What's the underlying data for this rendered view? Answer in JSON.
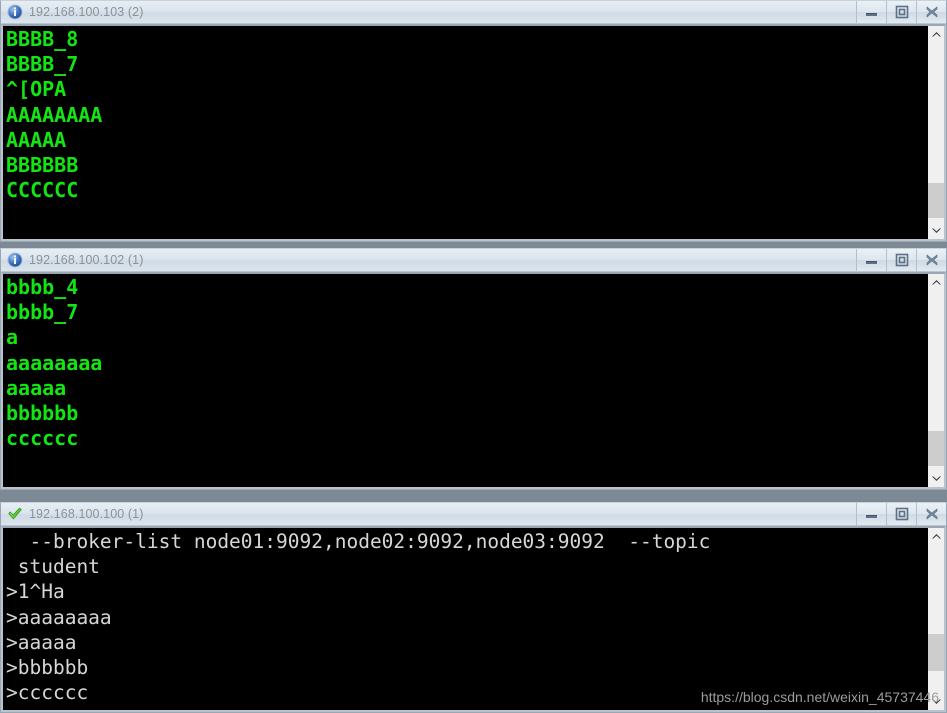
{
  "desktop": {
    "background_color": "#7d8a96",
    "watermark": "https://blog.csdn.net/weixin_45737446"
  },
  "window_buttons": {
    "minimize_label": "Minimize",
    "maximize_label": "Maximize",
    "close_label": "Close"
  },
  "windows": [
    {
      "id": "win-103",
      "title": "192.168.100.103 (2)",
      "icon": "blue-info-icon",
      "text_color": "#13e413",
      "background_color": "#000000",
      "lines": [
        "BBBB_8",
        "BBBB_7",
        "^[OPA",
        "AAAAAAAA",
        "AAAAA",
        "BBBBBB",
        "CCCCCC"
      ],
      "scrollbar": {
        "up_arrow": "scroll-up-icon",
        "down_arrow": "scroll-down-icon",
        "thumb_top_pct": 78,
        "thumb_height_pct": 20
      }
    },
    {
      "id": "win-102",
      "title": "192.168.100.102 (1)",
      "icon": "blue-info-icon",
      "text_color": "#13e413",
      "background_color": "#000000",
      "lines": [
        "bbbb_4",
        "bbbb_7",
        "a",
        "aaaaaaaa",
        "aaaaa",
        "bbbbbb",
        "cccccc"
      ],
      "scrollbar": {
        "up_arrow": "scroll-up-icon",
        "down_arrow": "scroll-down-icon",
        "thumb_top_pct": 78,
        "thumb_height_pct": 20
      }
    },
    {
      "id": "win-100",
      "title": "192.168.100.100 (1)",
      "icon": "green-check-icon",
      "text_color": "#d6d6d6",
      "background_color": "#000000",
      "lines": [
        "  --broker-list node01:9092,node02:9092,node03:9092  --topic",
        " student",
        ">1^Ha",
        ">aaaaaaaa",
        ">aaaaa",
        ">bbbbbb",
        ">cccccc"
      ],
      "scrollbar": {
        "up_arrow": "scroll-up-icon",
        "down_arrow": "scroll-down-icon",
        "thumb_top_pct": 60,
        "thumb_height_pct": 25
      }
    }
  ]
}
